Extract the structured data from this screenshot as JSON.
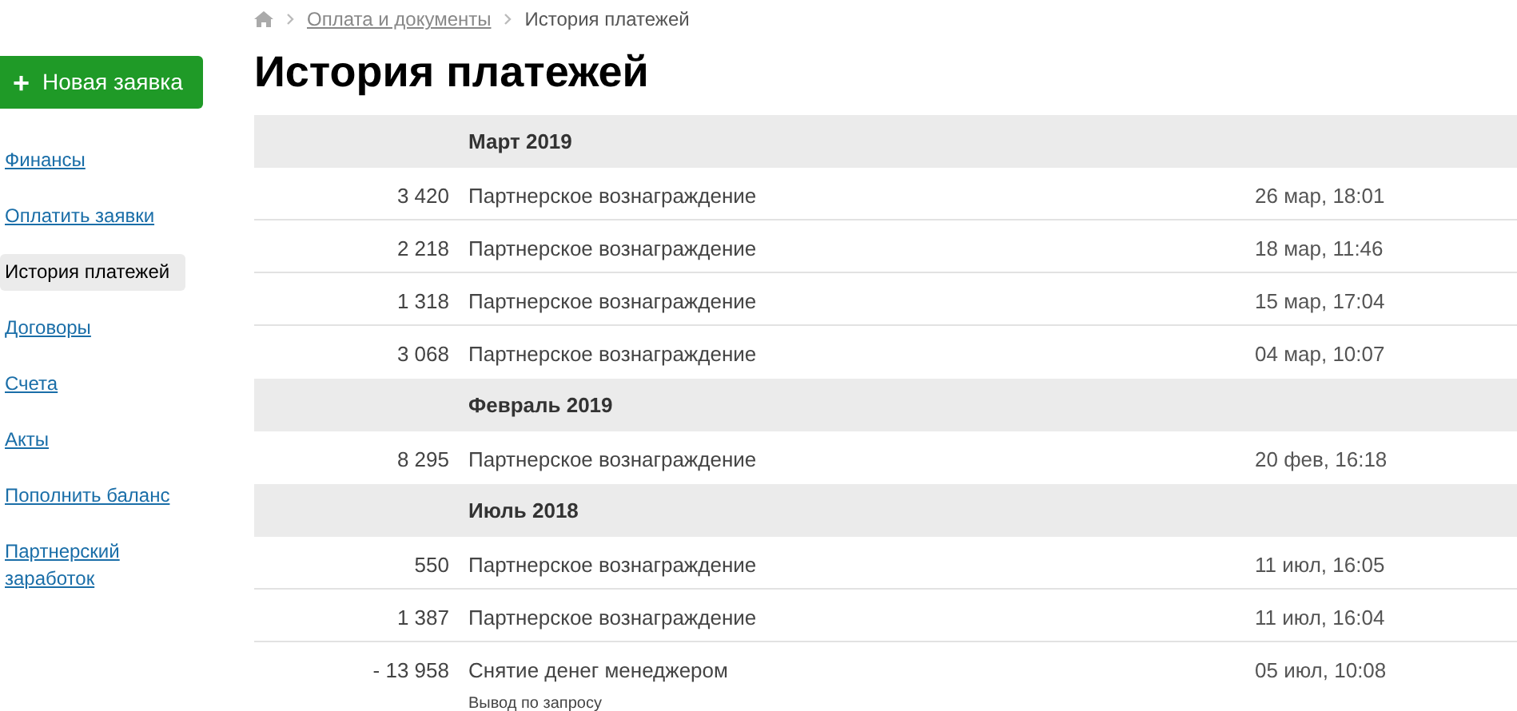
{
  "sidebar": {
    "new_button": {
      "icon": "+",
      "label": "Новая заявка"
    },
    "items": [
      {
        "label": "Финансы",
        "selected": false
      },
      {
        "label": "Оплатить заявки",
        "selected": false
      },
      {
        "label": "История платежей",
        "selected": true
      },
      {
        "label": "Договоры",
        "selected": false
      },
      {
        "label": "Счета",
        "selected": false
      },
      {
        "label": "Акты",
        "selected": false
      },
      {
        "label": "Пополнить баланс",
        "selected": false
      },
      {
        "label": "Партнерский заработок",
        "selected": false
      }
    ]
  },
  "breadcrumb": [
    {
      "label": "Оплата и документы",
      "kind": "link"
    },
    {
      "label": "История платежей",
      "kind": "current"
    }
  ],
  "title": "История платежей",
  "groups": [
    {
      "month": "Март 2019",
      "rows": [
        {
          "amount": "3 420",
          "description": "Партнерское вознаграждение",
          "date": "26 мар, 18:01"
        },
        {
          "amount": "2 218",
          "description": "Партнерское вознаграждение",
          "date": "18 мар, 11:46"
        },
        {
          "amount": "1 318",
          "description": "Партнерское вознаграждение",
          "date": "15 мар, 17:04"
        },
        {
          "amount": "3 068",
          "description": "Партнерское вознаграждение",
          "date": "04 мар, 10:07"
        }
      ]
    },
    {
      "month": "Февраль 2019",
      "rows": [
        {
          "amount": "8 295",
          "description": "Партнерское вознаграждение",
          "date": "20 фев, 16:18"
        }
      ]
    },
    {
      "month": "Июль 2018",
      "rows": [
        {
          "amount": "550",
          "description": "Партнерское вознаграждение",
          "date": "11 июл, 16:05"
        },
        {
          "amount": "1 387",
          "description": "Партнерское вознаграждение",
          "date": "11 июл, 16:04"
        },
        {
          "amount": "- 13 958",
          "description": "Снятие денег менеджером",
          "note": "Вывод по запросу",
          "date": "05 июл, 10:08"
        }
      ]
    }
  ]
}
